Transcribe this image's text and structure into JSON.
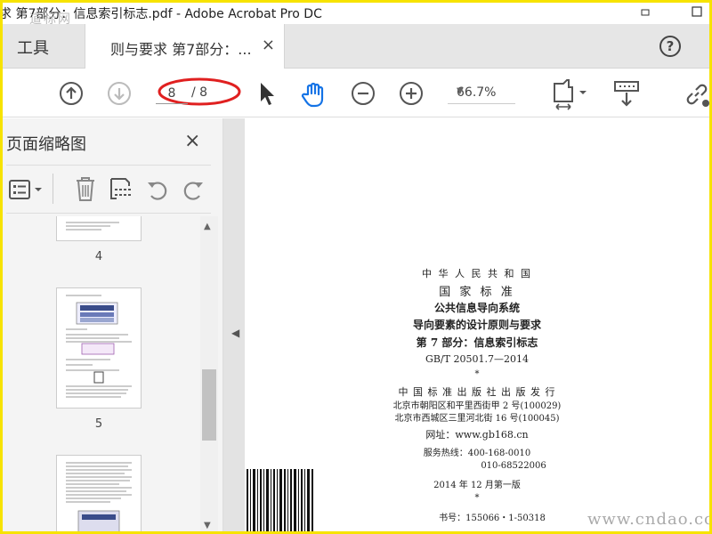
{
  "window": {
    "title": "求 第7部分：信息索引标志.pdf - Adobe Acrobat Pro DC",
    "watermark_top": "道标网",
    "minimize_glyph": "▫",
    "maximize_glyph": "□"
  },
  "tabs": {
    "tools_label": "工具",
    "doc_tab_label": "则与要求 第7部分：...",
    "close_glyph": "×",
    "help_glyph": "?"
  },
  "toolbar": {
    "page_current": "8",
    "page_total": "/ 8",
    "zoom": "66.7%",
    "highlight_color": "#e02020",
    "icons": [
      "previous-page-icon",
      "next-page-icon",
      "select-arrow-icon",
      "hand-tool-icon",
      "zoom-out-icon",
      "zoom-in-icon",
      "zoom-dropdown-icon",
      "fit-page-icon",
      "scroll-mode-icon",
      "link-icon"
    ]
  },
  "panel": {
    "title": "页面缩略图",
    "close_glyph": "×",
    "thumb_labels": [
      "4",
      "5"
    ]
  },
  "document": {
    "lines": [
      "中 华 人 民 共 和 国",
      "国 家 标 准",
      "公共信息导向系统",
      "导向要素的设计原则与要求",
      "第 7 部分：信息索引标志",
      "GB/T 20501.7—2014",
      "*",
      "中 国 标 准 出 版 社 出 版 发 行",
      "北京市朝阳区和平里西街甲 2 号(100029)",
      "北京市西城区三里河北街 16 号(100045)",
      "网址：www.gb168.cn",
      "服务热线：400-168-0010",
      "010-68522006",
      "2014 年 12 月第一版",
      "*",
      "书号：155066・1-50318"
    ],
    "watermark_bottom": "www.cndao.com"
  }
}
